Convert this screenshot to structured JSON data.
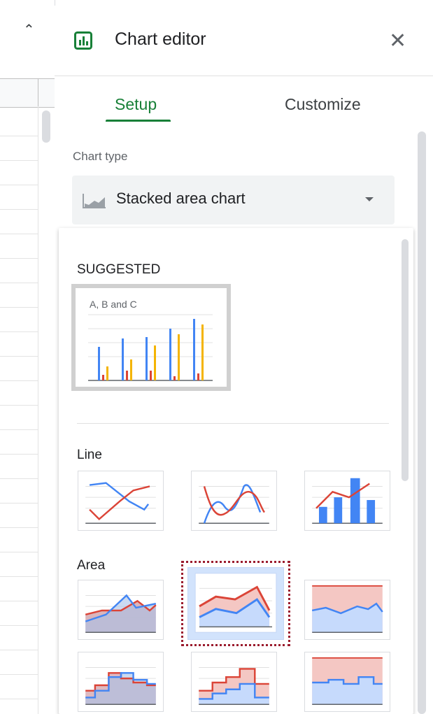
{
  "sheet": {
    "collapse_icon": "chevron-up-icon"
  },
  "editor": {
    "title": "Chart editor",
    "close_icon": "close-icon",
    "tabs": [
      {
        "label": "Setup",
        "active": true
      },
      {
        "label": "Customize",
        "active": false
      }
    ],
    "chart_type_label": "Chart type",
    "chart_type_value": "Stacked area chart",
    "accent_color": "#188038"
  },
  "chart_list": {
    "suggested_heading": "SUGGESTED",
    "suggested_items": [
      {
        "name": "column-chart",
        "title": "A, B and C"
      }
    ],
    "sections": [
      {
        "heading": "Line",
        "items": [
          "line-chart",
          "smooth-line-chart",
          "combo-chart"
        ]
      },
      {
        "heading": "Area",
        "items": [
          "area-chart",
          "stacked-area-chart",
          "100-stacked-area-chart",
          "stepped-area-chart",
          "stacked-stepped-area-chart",
          "100-stacked-stepped-area-chart"
        ]
      }
    ],
    "selected": "stacked-area-chart",
    "series_colors": {
      "blue": "#4285f4",
      "red": "#db4437",
      "yellow": "#f4b400"
    }
  }
}
